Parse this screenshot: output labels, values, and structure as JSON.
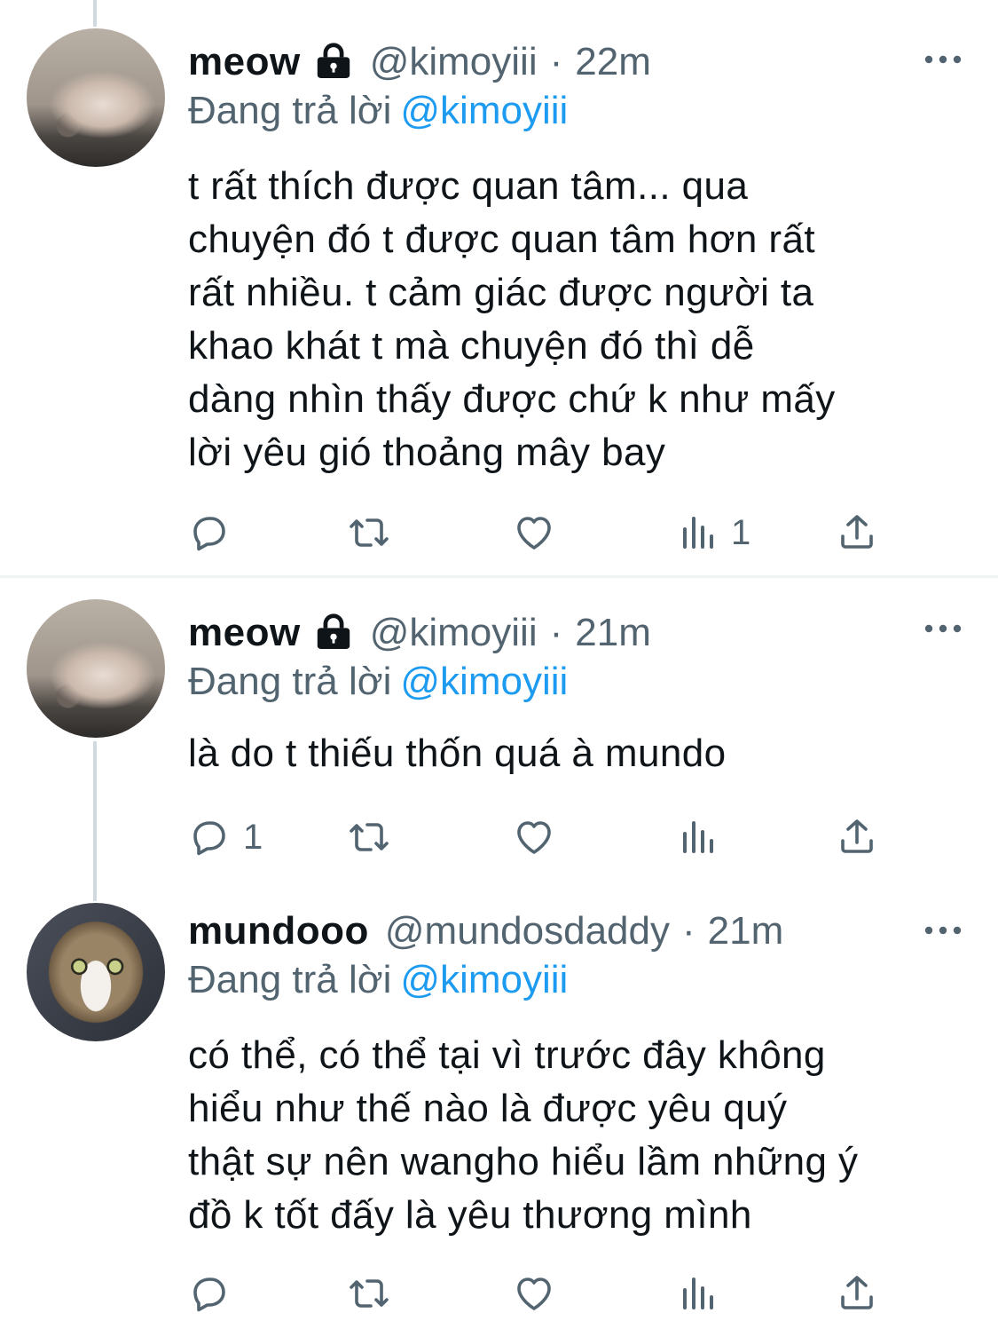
{
  "tweets": [
    {
      "name": "meow",
      "handle": "@kimoyiii",
      "separator": "·",
      "time": "22m",
      "reply_prefix": "Đang trả lời",
      "reply_to": "@kimoyiii",
      "text": "t rất thích được quan tâm... qua\nchuyện đó t được quan tâm hơn rất\nrất nhiều. t cảm giác được người ta\nkhao khát t mà chuyện đó thì dễ\ndàng nhìn thấy được chứ k như mấy\nlời yêu gió thoảng mây bay",
      "reply_count": "",
      "retweet_count": "",
      "like_count": "",
      "view_count": "1"
    },
    {
      "name": "meow",
      "handle": "@kimoyiii",
      "separator": "·",
      "time": "21m",
      "reply_prefix": "Đang trả lời",
      "reply_to": "@kimoyiii",
      "text": "là do t thiếu thốn quá à mundo",
      "reply_count": "1",
      "retweet_count": "",
      "like_count": "",
      "view_count": ""
    },
    {
      "name": "mundooo",
      "handle": "@mundosdaddy",
      "separator": "·",
      "time": "21m",
      "reply_prefix": "Đang trả lời",
      "reply_to": "@kimoyiii",
      "text": "có thể, có thể tại vì trước đây không\nhiểu như thế nào là được yêu quý\nthật sự nên wangho hiểu lầm những ý\nđồ k tốt đấy là yêu thương mình",
      "reply_count": "",
      "retweet_count": "",
      "like_count": "",
      "view_count": ""
    }
  ],
  "icons": {
    "lock": "lock-icon",
    "more": "more-icon",
    "reply": "reply-icon",
    "retweet": "retweet-icon",
    "like": "heart-icon",
    "views": "views-icon",
    "share": "share-icon"
  },
  "colors": {
    "text": "#0f1419",
    "secondary": "#536471",
    "link": "#1d9bf0",
    "thread_line": "#cfd9de",
    "divider": "#eff3f4"
  }
}
